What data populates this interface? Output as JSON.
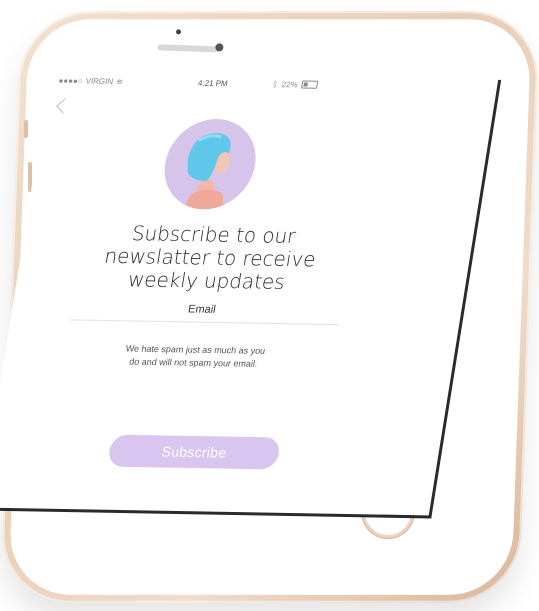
{
  "status_bar": {
    "carrier": "VIRGIN",
    "time": "4:21 PM",
    "battery": "22%"
  },
  "screen": {
    "headline_line1": "Subscribe to our",
    "headline_line2": "newslatter to receive",
    "headline_line3": "weekly updates",
    "email_label": "Email",
    "disclaimer_line1": "We hate spam just as much as you",
    "disclaimer_line2": "do and will not spam your email.",
    "subscribe_label": "Subscribe"
  },
  "colors": {
    "accent": "#d8c6f1",
    "avatar_bg": "#d6c4ea",
    "phone_gold": "#ecd3be"
  },
  "icons": {
    "back": "back-arrow-icon",
    "wifi": "wifi-icon",
    "battery": "battery-icon"
  }
}
